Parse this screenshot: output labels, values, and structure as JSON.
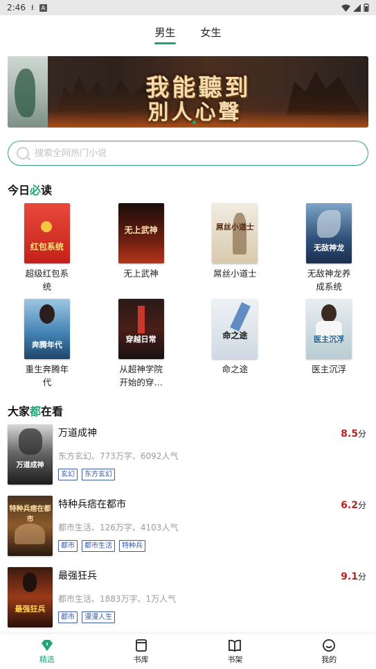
{
  "status_bar": {
    "time": "2:46"
  },
  "tabs": [
    {
      "label": "男生",
      "active": true
    },
    {
      "label": "女生",
      "active": false
    }
  ],
  "banner": {
    "line1": "我能聽到",
    "line2": "別人心聲"
  },
  "search": {
    "placeholder": "搜索全网热门小说",
    "value": ""
  },
  "today": {
    "title_pre": "今日",
    "title_hl": "必",
    "title_post": "读",
    "books": [
      {
        "name": "超级红包系统",
        "cover_text": "红包系统"
      },
      {
        "name": "无上武神",
        "cover_text": "无上武神"
      },
      {
        "name": "屌丝小道士",
        "cover_text": "屌丝小道士"
      },
      {
        "name": "无敌神龙养成系统",
        "cover_text": "无敌神龙"
      },
      {
        "name": "重生奔腾年代",
        "cover_text": "奔腾年代"
      },
      {
        "name": "从超神学院开始的穿…",
        "cover_text": "穿越日常"
      },
      {
        "name": "命之途",
        "cover_text": "命之途"
      },
      {
        "name": "医主沉浮",
        "cover_text": "医主沉浮"
      }
    ]
  },
  "popular": {
    "title_pre": "大家",
    "title_hl": "都",
    "title_post": "在看",
    "items": [
      {
        "title": "万道成神",
        "meta": "东方玄幻、773万字、6092人气",
        "tags": [
          "玄幻",
          "东方玄幻"
        ],
        "score": "8.5",
        "unit": "分",
        "cover_text": "万道成神"
      },
      {
        "title": "特种兵痞在都市",
        "meta": "都市生活、126万字、4103人气",
        "tags": [
          "都市",
          "都市生活",
          "特种兵"
        ],
        "score": "6.2",
        "unit": "分",
        "cover_text": "特种兵痞在都市"
      },
      {
        "title": "最强狂兵",
        "meta": "都市生活、1883万字、1万人气",
        "tags": [
          "都市",
          "漫漫人生"
        ],
        "score": "9.1",
        "unit": "分",
        "cover_text": "最强狂兵"
      }
    ]
  },
  "nav": [
    {
      "label": "精选",
      "icon": "diamond-icon",
      "active": true
    },
    {
      "label": "书库",
      "icon": "library-icon",
      "active": false
    },
    {
      "label": "书架",
      "icon": "book-icon",
      "active": false
    },
    {
      "label": "我的",
      "icon": "smile-icon",
      "active": false
    }
  ],
  "colors": {
    "accent": "#1fa57a",
    "score": "#c0201b",
    "tag": "#3b5ba8"
  }
}
